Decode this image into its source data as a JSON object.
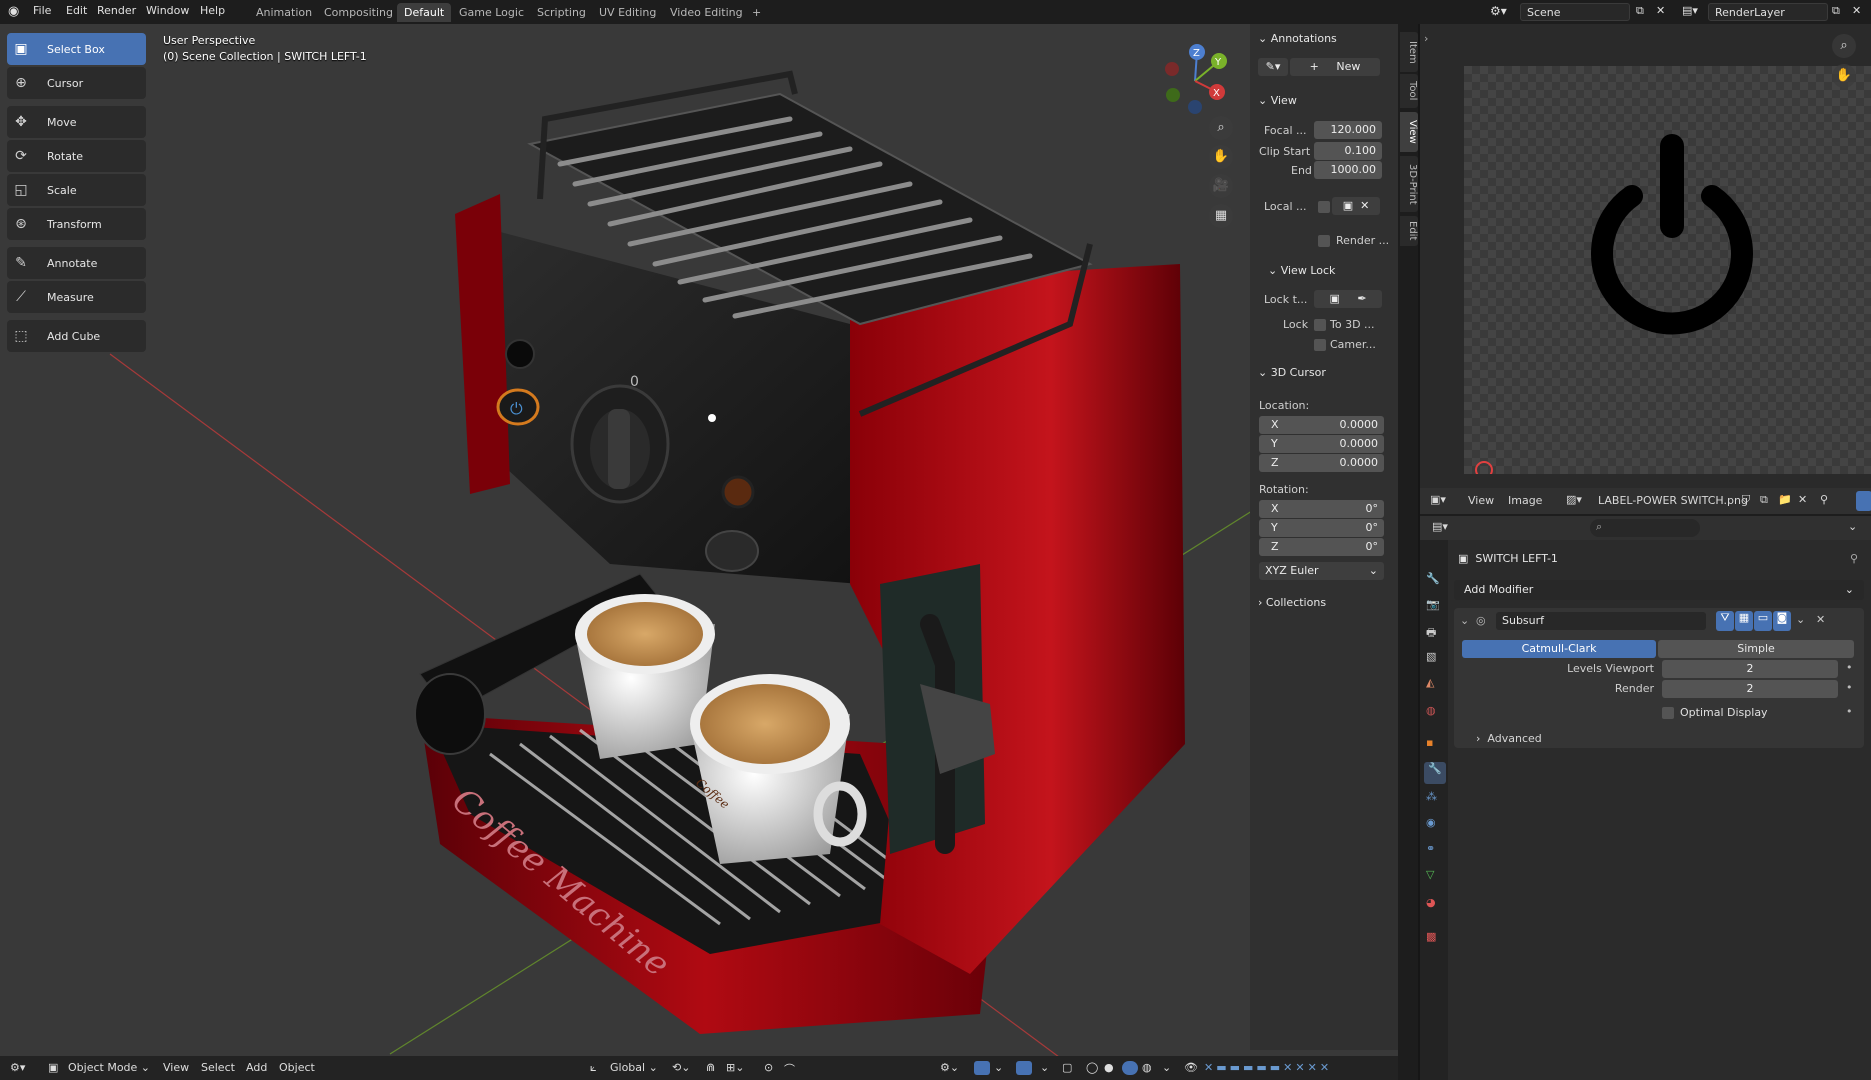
{
  "menu": {
    "items": [
      "File",
      "Edit",
      "Render",
      "Window",
      "Help"
    ],
    "workspaces": [
      "Animation",
      "Compositing",
      "Default",
      "Game Logic",
      "Scripting",
      "UV Editing",
      "Video Editing"
    ],
    "add_tab": "+",
    "active_workspace": "Default",
    "scene": "Scene",
    "render_layer": "RenderLayer"
  },
  "viewport": {
    "perspective": "User Perspective",
    "collection": "(0) Scene Collection | SWITCH LEFT-1",
    "machine_text": "Coffee Machine",
    "cup_text": "Coffee",
    "dial_zero": "0"
  },
  "gizmo": {
    "x": "X",
    "y": "Y",
    "z": "Z"
  },
  "toolbar": [
    {
      "label": "Select Box",
      "icon": "select-box-icon",
      "glyph": "▣",
      "active": true
    },
    {
      "label": "Cursor",
      "icon": "cursor-icon",
      "glyph": "⊕",
      "active": false
    },
    {
      "label": "Move",
      "icon": "move-icon",
      "glyph": "✥",
      "active": false
    },
    {
      "label": "Rotate",
      "icon": "rotate-icon",
      "glyph": "⟳",
      "active": false
    },
    {
      "label": "Scale",
      "icon": "scale-icon",
      "glyph": "◱",
      "active": false
    },
    {
      "label": "Transform",
      "icon": "transform-icon",
      "glyph": "⊛",
      "active": false
    },
    {
      "label": "Annotate",
      "icon": "annotate-icon",
      "glyph": "✎",
      "active": false
    },
    {
      "label": "Measure",
      "icon": "measure-icon",
      "glyph": "📐",
      "active": false
    },
    {
      "label": "Add Cube",
      "icon": "add-cube-icon",
      "glyph": "⬚",
      "active": false
    }
  ],
  "npanel": {
    "annotations": "Annotations",
    "new_label": "New",
    "view": "View",
    "focal_label": "Focal ...",
    "focal_value": "120.000",
    "clip_start_label": "Clip Start",
    "clip_start_value": "0.100",
    "end_label": "End",
    "end_value": "1000.00",
    "local_label": "Local ...",
    "render_label": "Render ...",
    "view_lock": "View Lock",
    "lock_t_label": "Lock t...",
    "lock_label": "Lock",
    "to_3d_label": "To 3D ...",
    "camera_label": "Camer...",
    "cursor3d": "3D Cursor",
    "location_label": "Location:",
    "loc_x": "0.0000",
    "loc_y": "0.0000",
    "loc_z": "0.0000",
    "rotation_label": "Rotation:",
    "rot_x": "0°",
    "rot_y": "0°",
    "rot_z": "0°",
    "euler": "XYZ Euler",
    "collections": "Collections",
    "axis_x": "X",
    "axis_y": "Y",
    "axis_z": "Z"
  },
  "vtabs": [
    "Item",
    "Tool",
    "View",
    "3D-Print",
    "Edit"
  ],
  "image_editor": {
    "view": "View",
    "image": "Image",
    "filename": "LABEL-POWER SWITCH.png"
  },
  "properties": {
    "object_name": "SWITCH LEFT-1",
    "add_modifier": "Add Modifier",
    "modifier_name": "Subsurf",
    "catmull": "Catmull-Clark",
    "simple": "Simple",
    "levels_viewport_label": "Levels Viewport",
    "levels_viewport_value": "2",
    "render_label": "Render",
    "render_value": "2",
    "optimal_display": "Optimal Display",
    "advanced": "Advanced"
  },
  "bottombar": {
    "mode": "Object Mode",
    "view": "View",
    "select": "Select",
    "add": "Add",
    "object": "Object",
    "orientation": "Global"
  },
  "colors": {
    "accent": "#4772b3",
    "machine_red": "#a0000a",
    "x_axis": "#c23a3a",
    "y_axis": "#6a9a2a"
  }
}
